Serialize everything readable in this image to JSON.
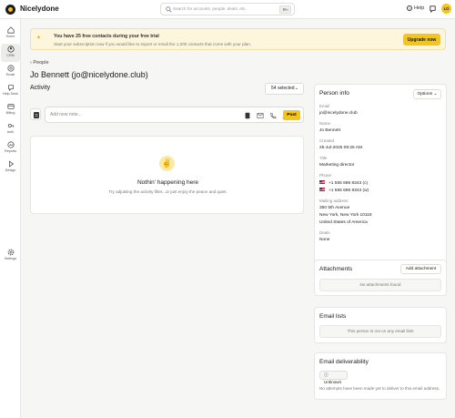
{
  "app": {
    "name": "Nicelydone"
  },
  "search": {
    "placeholder": "Search for accounts, people, deals, etc.",
    "shortcut": "⌘K"
  },
  "header": {
    "help_label": "Help",
    "avatar_initials": "LO"
  },
  "sidebar": {
    "items": [
      {
        "label": "Home",
        "icon": "home-icon"
      },
      {
        "label": "CRM",
        "icon": "crm-icon",
        "active": true
      },
      {
        "label": "Email",
        "icon": "email-icon"
      },
      {
        "label": "Help Desk",
        "icon": "helpdesk-icon"
      },
      {
        "label": "Billing",
        "icon": "billing-icon"
      },
      {
        "label": "Auth",
        "icon": "auth-icon"
      },
      {
        "label": "Reports",
        "icon": "reports-icon"
      },
      {
        "label": "Design",
        "icon": "design-icon"
      },
      {
        "label": "Settings",
        "icon": "gear-icon"
      }
    ]
  },
  "banner": {
    "title": "You have 25 free contacts during your free trial",
    "text": "Start your subscription now if you would like to import or email the 1,000 contacts that come with your plan.",
    "button": "Upgrade now"
  },
  "breadcrumb": {
    "label": "People"
  },
  "page": {
    "title": "Jo Bennett (jo@nicelydone.club)"
  },
  "activity": {
    "heading": "Activity",
    "filter": "54 selected",
    "note_placeholder": "Add new note...",
    "post_label": "Post",
    "empty_title": "Nothin' happening here",
    "empty_text": "Try adjusting the activity filter...or just enjoy the peace and quiet."
  },
  "person_info": {
    "heading": "Person info",
    "options_label": "Options",
    "email_label": "Email",
    "email": "jo@nicelydone.club",
    "name_label": "Name",
    "name": "Jo Bennett",
    "created_label": "Created",
    "created": "25-Jul-2025 09:25 AM",
    "title_label": "Title",
    "title": "Marketing director",
    "phone_label": "Phone",
    "phone_1": "+1 555 696 8343 (c)",
    "phone_2": "+1 555 696 8343 (w)",
    "address_label": "Mailing address",
    "address_1": "350 5th Avenue",
    "address_2": "New York, New York 10118",
    "address_3": "United States of America",
    "deals_label": "Deals",
    "deals": "None"
  },
  "attachments": {
    "heading": "Attachments",
    "add_label": "Add attachment",
    "empty": "No attachments found"
  },
  "email_lists": {
    "heading": "Email lists",
    "empty": "This person is not on any email lists"
  },
  "deliverability": {
    "heading": "Email deliverability",
    "status": "Unknown",
    "note": "No attempts have been made yet to deliver to this email address."
  },
  "colors": {
    "accent": "#f5c518",
    "banner_bg": "#fdf6dd"
  }
}
